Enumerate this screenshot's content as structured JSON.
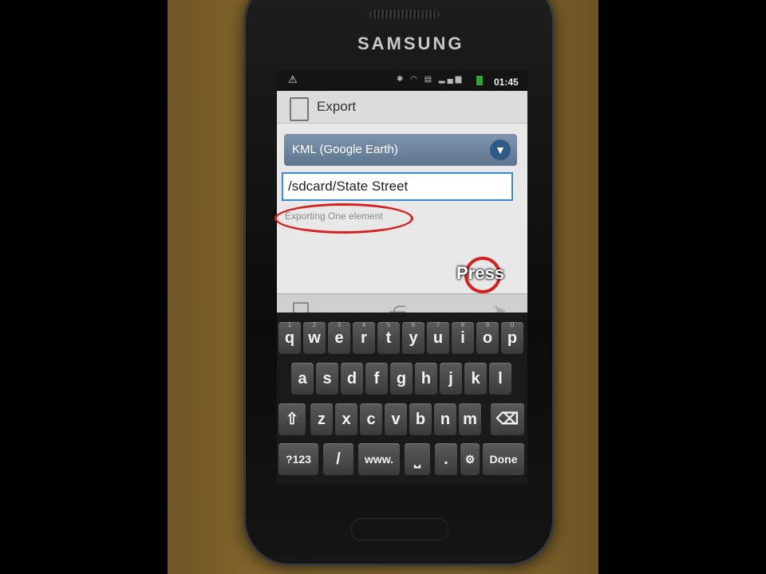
{
  "brand": "SAMSUNG",
  "status_bar": {
    "time": "01:45",
    "icons": [
      "warning-icon",
      "bluetooth-icon",
      "wifi-icon",
      "sd-icon",
      "signal-icon",
      "battery-icon"
    ]
  },
  "dialog": {
    "title": "Export",
    "format_select": "KML (Google Earth)",
    "path_value": "/sdcard/State Street",
    "hint_text": "Exporting One element"
  },
  "annotation": {
    "press_label": "Press",
    "ring_color": "#d52020"
  },
  "keyboard": {
    "row1": [
      {
        "k": "q",
        "n": "1"
      },
      {
        "k": "w",
        "n": "2"
      },
      {
        "k": "e",
        "n": "3"
      },
      {
        "k": "r",
        "n": "4"
      },
      {
        "k": "t",
        "n": "5"
      },
      {
        "k": "y",
        "n": "6"
      },
      {
        "k": "u",
        "n": "7"
      },
      {
        "k": "i",
        "n": "8"
      },
      {
        "k": "o",
        "n": "9"
      },
      {
        "k": "p",
        "n": "0"
      }
    ],
    "row2": [
      "a",
      "s",
      "d",
      "f",
      "g",
      "h",
      "j",
      "k",
      "l"
    ],
    "row3": [
      "z",
      "x",
      "c",
      "v",
      "b",
      "n",
      "m"
    ],
    "shift_glyph": "⇧",
    "backspace_glyph": "⌫",
    "sym_label": "?123",
    "slash_label": "/",
    "www_label": "www.",
    "space_glyph": "⎵",
    "dot_label": ".",
    "settings_glyph": "⚙",
    "done_label": "Done"
  }
}
